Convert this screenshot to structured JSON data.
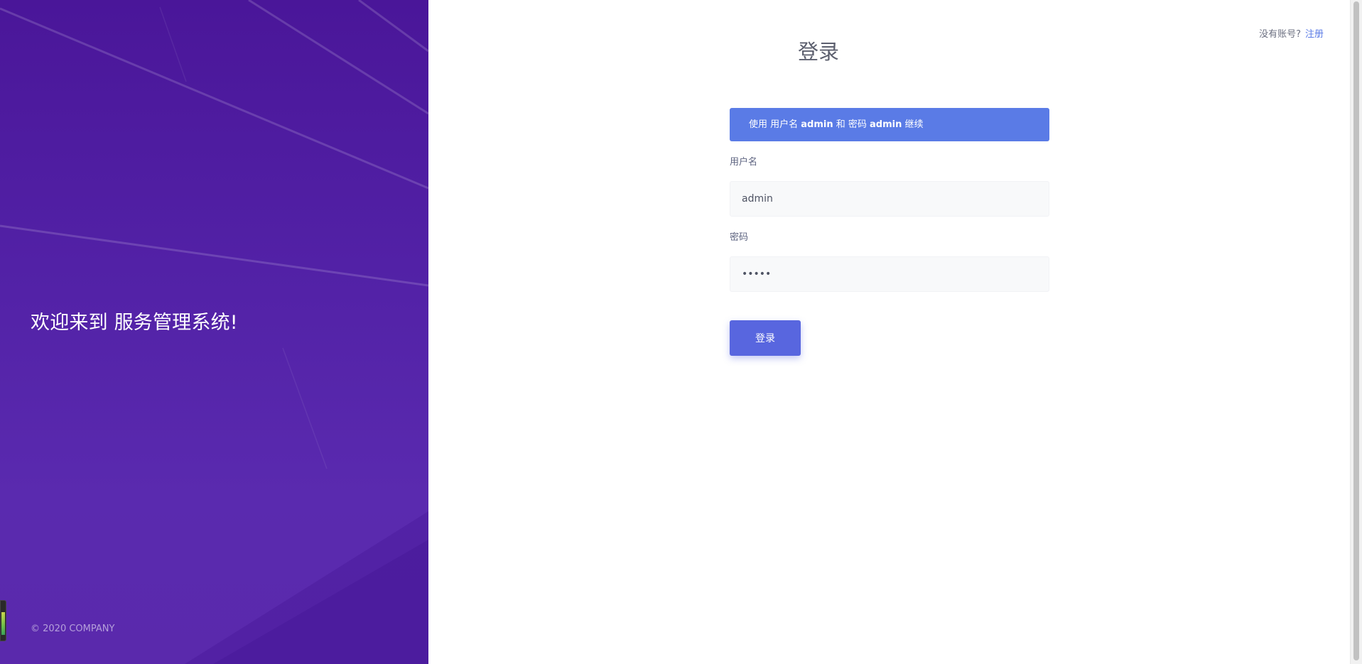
{
  "hero": {
    "title": "欢迎来到 服务管理系统!",
    "footer": "© 2020 COMPANY"
  },
  "header": {
    "no_account_text": "没有账号?",
    "register_link": "注册"
  },
  "login": {
    "title": "登录",
    "alert": {
      "prefix": "使用 用户名 ",
      "username_hint": "admin",
      "middle": " 和 密码 ",
      "password_hint": "admin",
      "suffix": " 继续"
    },
    "username_label": "用户名",
    "username_value": "admin",
    "password_label": "密码",
    "password_value": "admin",
    "submit_label": "登录"
  },
  "colors": {
    "hero_gradient_top": "#4a1699",
    "hero_gradient_bottom": "#5a29ac",
    "accent": "#5a7be6",
    "button": "#5866df"
  }
}
